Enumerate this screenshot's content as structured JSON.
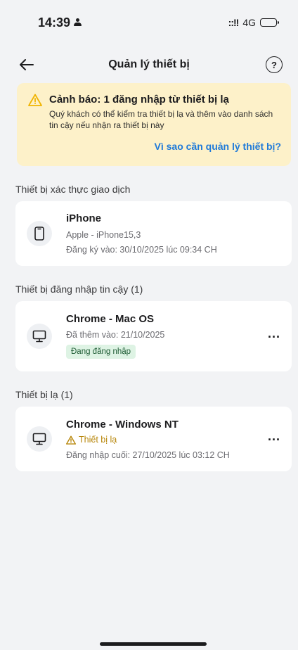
{
  "status_bar": {
    "time": "14:39",
    "signal": "::!!",
    "network": "4G"
  },
  "nav": {
    "title": "Quản lý thiết bị",
    "help_icon": "?"
  },
  "alert": {
    "title": "Cảnh báo: 1 đăng nhập từ thiết bị lạ",
    "description": "Quý khách có thể kiểm tra thiết bị lạ và thêm vào danh sách tin cậy nếu nhận ra thiết bị này",
    "link": "Vì sao cần quản lý thiết bị?",
    "accent_color": "#f0b400",
    "link_color": "#1f7ad9"
  },
  "sections": {
    "transaction": {
      "title": "Thiết bị xác thực giao dịch",
      "device": {
        "name": "iPhone",
        "model": "Apple - iPhone15,3",
        "registered": "Đăng ký vào: 30/10/2025 lúc 09:34 CH",
        "icon": "phone-icon"
      }
    },
    "trusted": {
      "title": "Thiết bị đăng nhập tin cậy (1)",
      "device": {
        "name": "Chrome - Mac OS",
        "added": "Đã thêm vào: 21/10/2025",
        "badge": "Đang đăng nhập",
        "more": "...",
        "icon": "monitor-icon"
      }
    },
    "strange": {
      "title": "Thiết bị lạ (1)",
      "device": {
        "name": "Chrome - Windows NT",
        "warning": "Thiết bị lạ",
        "last_login": "Đăng nhập cuối: 27/10/2025 lúc 03:12 CH",
        "more": "...",
        "icon": "monitor-icon"
      }
    }
  }
}
